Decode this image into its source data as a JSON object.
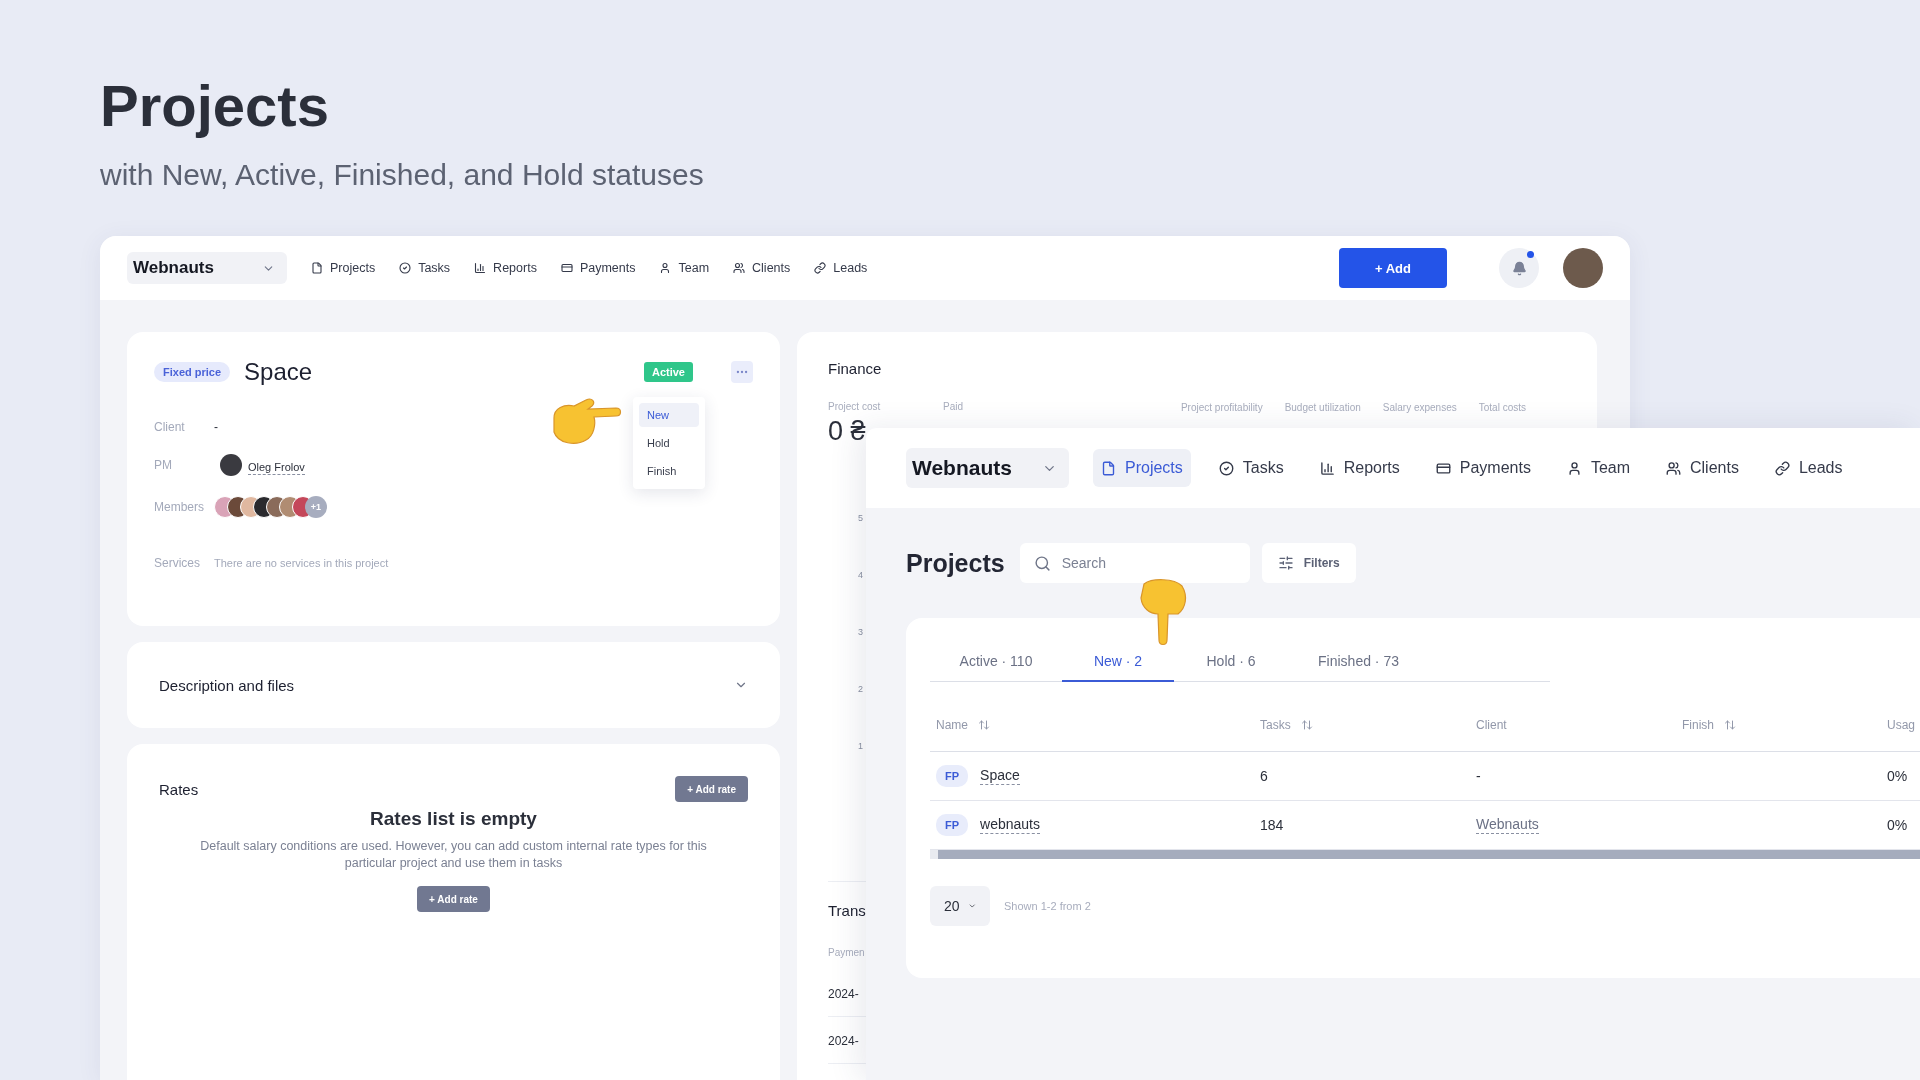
{
  "hero": {
    "title": "Projects",
    "subtitle": "with New, Active, Finished, and Hold statuses"
  },
  "back_window": {
    "workspace": "Webnauts",
    "nav": [
      {
        "label": "Projects"
      },
      {
        "label": "Tasks"
      },
      {
        "label": "Reports"
      },
      {
        "label": "Payments"
      },
      {
        "label": "Team"
      },
      {
        "label": "Clients"
      },
      {
        "label": "Leads"
      }
    ],
    "add_button": "+ Add",
    "notifications": {
      "unread": true
    },
    "project_card": {
      "badge": "Fixed price",
      "title": "Space",
      "status": "Active",
      "status_menu": [
        {
          "label": "New",
          "selected": true
        },
        {
          "label": "Hold",
          "selected": false
        },
        {
          "label": "Finish",
          "selected": false
        }
      ],
      "client": {
        "label": "Client",
        "value": "-"
      },
      "pm": {
        "label": "PM",
        "value": "Oleg Frolov"
      },
      "members": {
        "label": "Members",
        "more": "+1"
      },
      "services": {
        "label": "Services",
        "value": "There are no services in this project"
      }
    },
    "description_card": {
      "title": "Description and files",
      "expanded": false
    },
    "rates_card": {
      "title": "Rates",
      "add_button": "+ Add rate",
      "empty_title": "Rates list is empty",
      "empty_text": "Default salary conditions are used. However, you can add custom internal rate types for this particular project and use them in tasks",
      "empty_button": "+ Add rate"
    },
    "finance_card": {
      "title": "Finance",
      "stats": [
        {
          "label": "Project cost",
          "value": "0 ₴"
        },
        {
          "label": "Paid"
        }
      ],
      "metrics": [
        "Project profitability",
        "Budget utilization",
        "Salary expenses",
        "Total costs"
      ],
      "axis_ticks": [
        "5",
        "4",
        "3",
        "2",
        "1"
      ],
      "transactions": {
        "title": "Trans",
        "column": "Paymen",
        "rows": [
          "2024-",
          "2024-"
        ]
      }
    }
  },
  "front_window": {
    "workspace": "Webnauts",
    "nav": [
      {
        "label": "Projects",
        "selected": true
      },
      {
        "label": "Tasks",
        "selected": false
      },
      {
        "label": "Reports",
        "selected": false
      },
      {
        "label": "Payments",
        "selected": false
      },
      {
        "label": "Team",
        "selected": false
      },
      {
        "label": "Clients",
        "selected": false
      },
      {
        "label": "Leads",
        "selected": false
      }
    ],
    "page_title": "Projects",
    "search": {
      "placeholder": "Search"
    },
    "filters_button": "Filters",
    "tabs": [
      {
        "label": "Active · 110",
        "selected": false
      },
      {
        "label": "New · 2",
        "selected": true
      },
      {
        "label": "Hold · 6",
        "selected": false
      },
      {
        "label": "Finished · 73",
        "selected": false
      }
    ],
    "columns": [
      {
        "label": "Name",
        "sortable": true
      },
      {
        "label": "Tasks",
        "sortable": true
      },
      {
        "label": "Client",
        "sortable": false
      },
      {
        "label": "Finish",
        "sortable": true
      },
      {
        "label": "Usag"
      }
    ],
    "rows": [
      {
        "type": "FP",
        "name": "Space",
        "tasks": "6",
        "client": "-",
        "client_link": false,
        "usage": "0%"
      },
      {
        "type": "FP",
        "name": "webnauts",
        "tasks": "184",
        "client": "Webnauts",
        "client_link": true,
        "usage": "0%"
      }
    ],
    "page_size": "20",
    "shown": "Shown 1-2 from 2"
  }
}
